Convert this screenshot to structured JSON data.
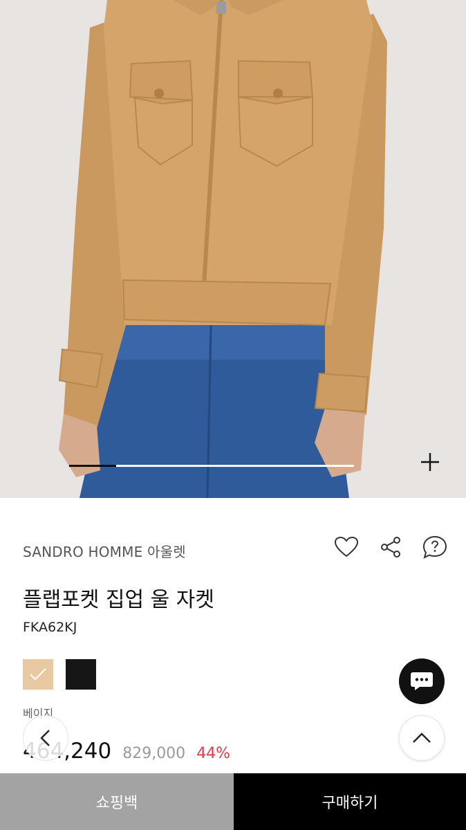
{
  "gallery": {
    "progress_fraction": 0.165
  },
  "product": {
    "brand": "SANDRO HOMME 아울렛",
    "title": "플랩포켓 집업 울 자켓",
    "code": "FKA62KJ",
    "selected_color_label": "베이지",
    "swatches": [
      {
        "name": "beige",
        "color": "#e9c9a2",
        "selected": true
      },
      {
        "name": "black",
        "color": "#161616",
        "selected": false
      }
    ]
  },
  "price": {
    "sale": "464,240",
    "original": "829,000",
    "discount": "44%"
  },
  "icons": {
    "wishlist": "heart-icon",
    "share": "share-icon",
    "inquiry": "question-bubble-icon",
    "chat": "chat-icon",
    "back": "chevron-left-icon",
    "scroll_top": "chevron-up-icon",
    "zoom": "plus-icon"
  },
  "bottom_bar": {
    "bag_label": "쇼핑백",
    "buy_label": "구매하기"
  }
}
